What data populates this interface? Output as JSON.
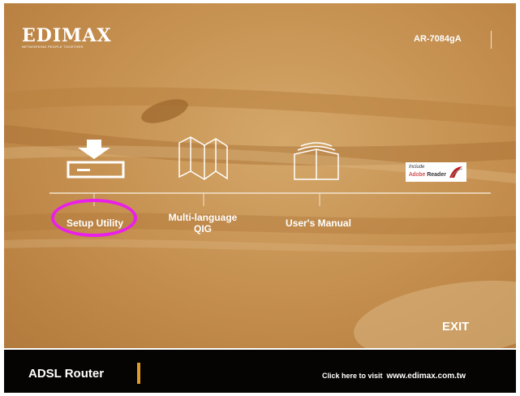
{
  "brand": {
    "logo_text": "EDIMAX",
    "tagline": "NETWORKING PEOPLE TOGETHER"
  },
  "model": "AR-7084gA",
  "menu": {
    "setup_utility": "Setup Utility",
    "qig_line1": "Multi-language",
    "qig_line2": "QIG",
    "manual": "User's Manual",
    "adobe_included": "Include",
    "adobe_name": "Adobe",
    "adobe_product": "Reader"
  },
  "exit_label": "EXIT",
  "footer": {
    "product": "ADSL Router",
    "visit_prefix": "Click here to visit",
    "url": "www.edimax.com.tw"
  },
  "colors": {
    "panel": "#c48e4e",
    "highlight": "#ea1fea",
    "footer": "#050403",
    "footer_accent": "#e09a2c"
  }
}
